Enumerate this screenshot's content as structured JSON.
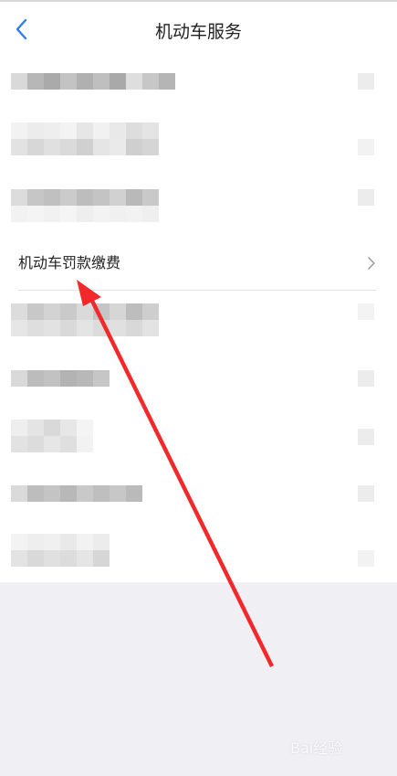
{
  "header": {
    "title": "机动车服务",
    "back_icon": "chevron-left-icon"
  },
  "list": {
    "focused_item": {
      "label": "机动车罚款缴费",
      "icon": "chevron-right-icon"
    },
    "blurred_item_count": 8
  },
  "annotation": {
    "arrow_color": "#f02a2a"
  },
  "watermark": {
    "text": "Bai经验"
  },
  "colors": {
    "accent": "#2f7cf6",
    "page_background": "#efeff4",
    "card_background": "#ffffff"
  }
}
